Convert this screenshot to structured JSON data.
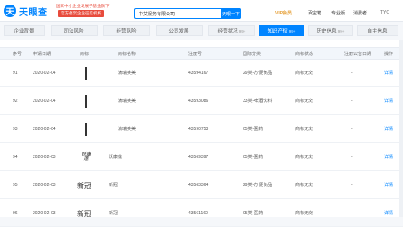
{
  "header": {
    "logo_mark": "天",
    "logo_text": "天眼查",
    "promo_line1": "国家中小企业发展子基金旗下",
    "promo_line2": "官方备案企业征信机构",
    "search_value": "中艾服务有限公司",
    "search_button": "天眼一下",
    "nav": [
      "VIP会员",
      "百宝箱",
      "专业版",
      "消费者",
      "TYC"
    ]
  },
  "tabs": [
    {
      "label": "企业背景",
      "count": ""
    },
    {
      "label": "司法风险",
      "count": ""
    },
    {
      "label": "经营风险",
      "count": ""
    },
    {
      "label": "公司发展",
      "count": ""
    },
    {
      "label": "经营状况",
      "count": "99+"
    },
    {
      "label": "知识产权",
      "count": "99+"
    },
    {
      "label": "历史信息",
      "count": "99+"
    },
    {
      "label": "自主信息",
      "count": ""
    }
  ],
  "table": {
    "columns": [
      "序号",
      "申请日期",
      "商标",
      "商标名称",
      "注册号",
      "国际分类",
      "商标状态",
      "注册公告日期",
      "操作"
    ],
    "rows": [
      {
        "no": "91",
        "date": "2020-02-04",
        "name": "满瑞奥美",
        "reg": "43594167",
        "class": "29类-方便食品",
        "status": "商标无效",
        "pub": "-",
        "op": "详情",
        "mark": "vert"
      },
      {
        "no": "92",
        "date": "2020-02-04",
        "name": "满瑞奥美",
        "reg": "43593086",
        "class": "33类-啤酒饮料",
        "status": "商标无效",
        "pub": "-",
        "op": "详情",
        "mark": "vert"
      },
      {
        "no": "93",
        "date": "2020-02-04",
        "name": "满瑞奥美",
        "reg": "43590753",
        "class": "05类-医药",
        "status": "商标无效",
        "pub": "-",
        "op": "详情",
        "mark": "vert"
      },
      {
        "no": "94",
        "date": "2020-02-03",
        "name": "跃康莲",
        "reg": "43569397",
        "class": "05类-医药",
        "status": "商标无效",
        "pub": "-",
        "op": "详情",
        "mark": "calli",
        "mark_text": "跃康莲"
      },
      {
        "no": "95",
        "date": "2020-02-03",
        "name": "新冠",
        "reg": "43563364",
        "class": "29类-方便食品",
        "status": "商标无效",
        "pub": "-",
        "op": "详情",
        "mark": "print",
        "mark_text": "新冠"
      },
      {
        "no": "96",
        "date": "2020-02-03",
        "name": "新冠",
        "reg": "43561160",
        "class": "05类-医药",
        "status": "商标无效",
        "pub": "-",
        "op": "详情",
        "mark": "print",
        "mark_text": "新冠"
      }
    ]
  }
}
